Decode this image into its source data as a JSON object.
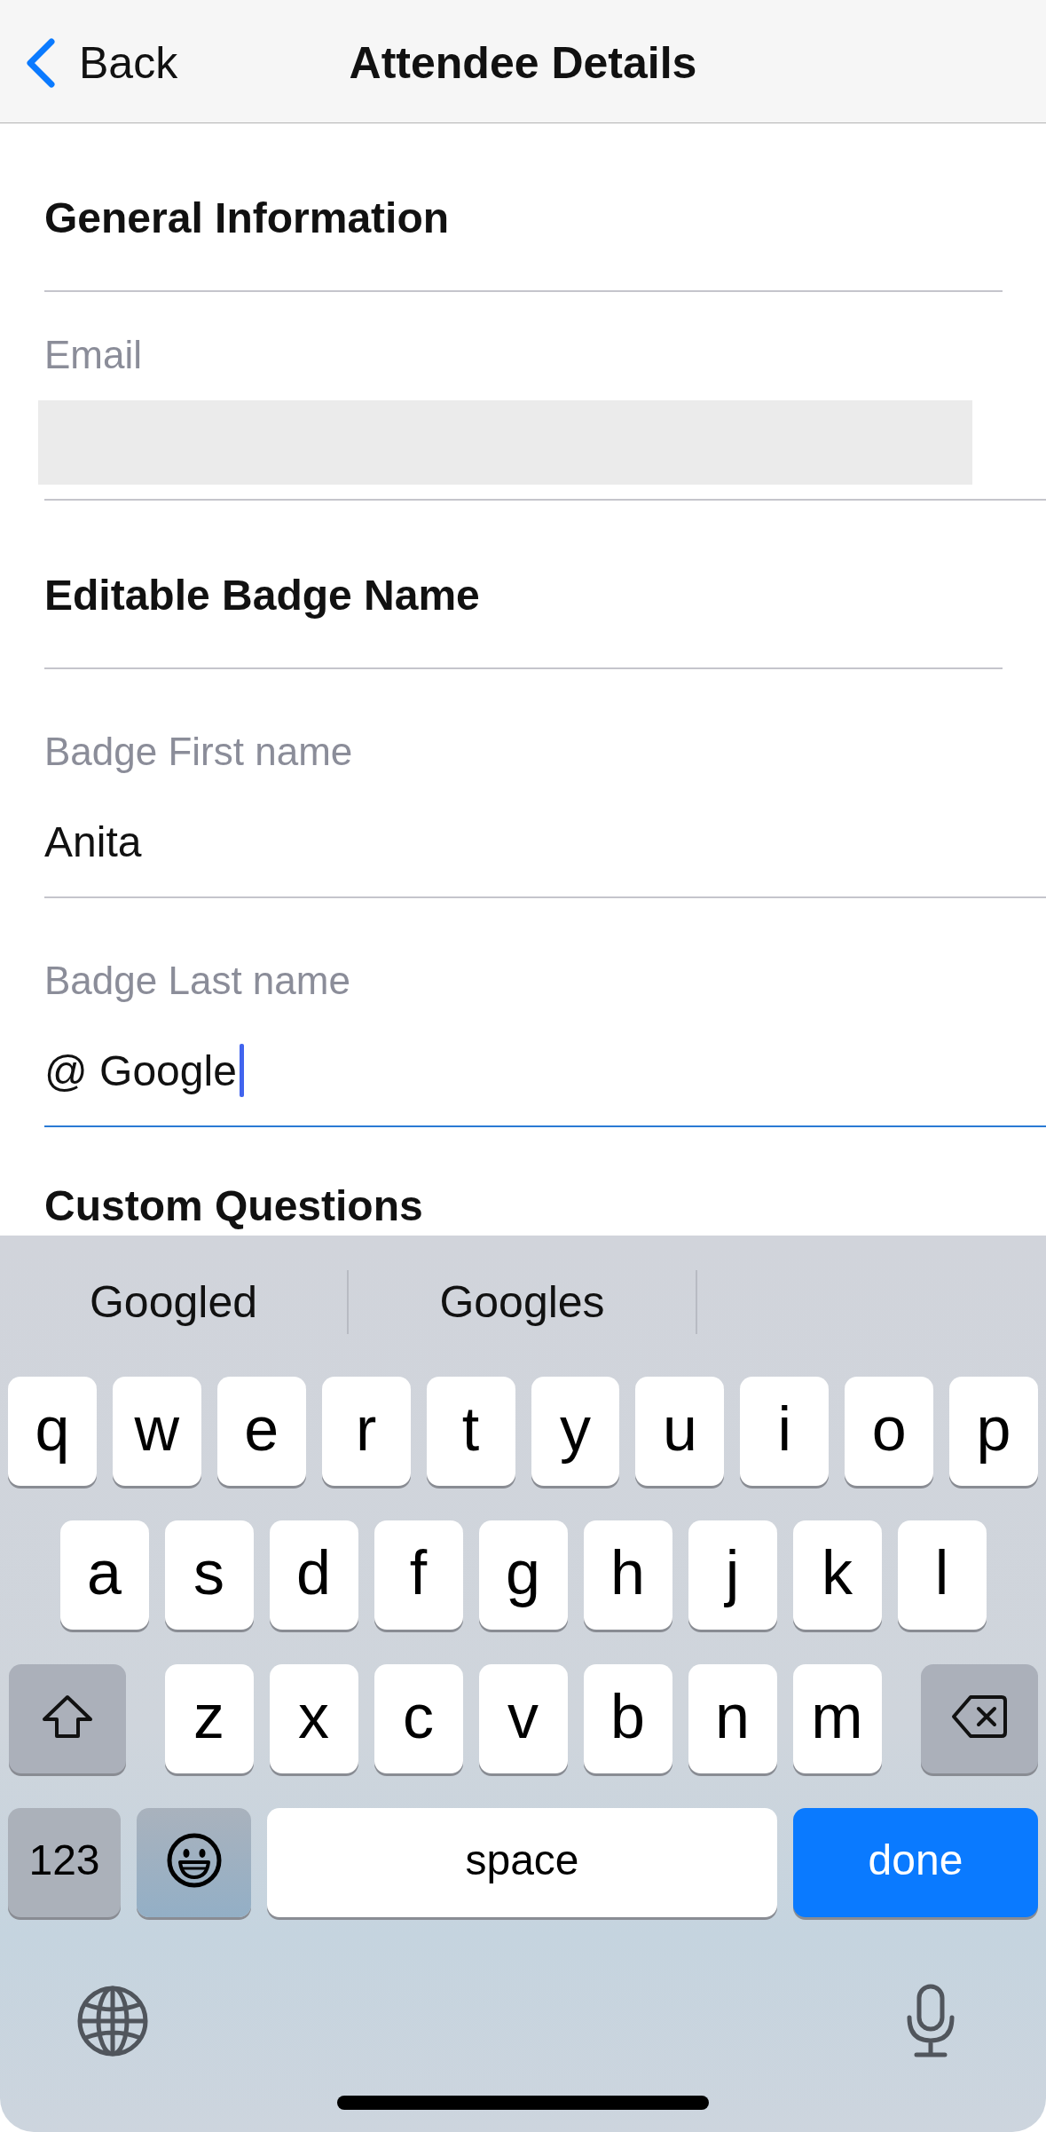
{
  "nav": {
    "back_label": "Back",
    "title": "Attendee Details"
  },
  "sections": [
    {
      "heading": "General Information",
      "fields": [
        {
          "label": "Email",
          "disabled": true,
          "focused": false
        }
      ]
    },
    {
      "heading": "Editable Badge Name",
      "fields": [
        {
          "label": "Badge First name",
          "value": "Anita",
          "disabled": false,
          "focused": false
        },
        {
          "label": "Badge Last name",
          "value": "@ Google",
          "disabled": false,
          "focused": true
        }
      ]
    },
    {
      "heading": "Custom Questions"
    }
  ],
  "keyboard": {
    "suggestions": [
      "Googled",
      "Googles"
    ],
    "key_rows": [
      {
        "keys": [
          {
            "kind": "letter",
            "label": "q"
          },
          {
            "kind": "letter",
            "label": "w"
          },
          {
            "kind": "letter",
            "label": "e"
          },
          {
            "kind": "letter",
            "label": "r"
          },
          {
            "kind": "letter",
            "label": "t"
          },
          {
            "kind": "letter",
            "label": "y"
          },
          {
            "kind": "letter",
            "label": "u"
          },
          {
            "kind": "letter",
            "label": "i"
          },
          {
            "kind": "letter",
            "label": "o"
          },
          {
            "kind": "letter",
            "label": "p"
          }
        ]
      },
      {
        "keys": [
          {
            "kind": "letter",
            "label": "a"
          },
          {
            "kind": "letter",
            "label": "s"
          },
          {
            "kind": "letter",
            "label": "d"
          },
          {
            "kind": "letter",
            "label": "f"
          },
          {
            "kind": "letter",
            "label": "g"
          },
          {
            "kind": "letter",
            "label": "h"
          },
          {
            "kind": "letter",
            "label": "j"
          },
          {
            "kind": "letter",
            "label": "k"
          },
          {
            "kind": "letter",
            "label": "l"
          }
        ]
      },
      {
        "keys": [
          {
            "kind": "shift"
          },
          {
            "kind": "letter",
            "label": "z"
          },
          {
            "kind": "letter",
            "label": "x"
          },
          {
            "kind": "letter",
            "label": "c"
          },
          {
            "kind": "letter",
            "label": "v"
          },
          {
            "kind": "letter",
            "label": "b"
          },
          {
            "kind": "letter",
            "label": "n"
          },
          {
            "kind": "letter",
            "label": "m"
          },
          {
            "kind": "delete"
          }
        ]
      },
      {
        "keys": [
          {
            "kind": "mode",
            "label": "123"
          },
          {
            "kind": "emoji"
          },
          {
            "kind": "space",
            "label": "space"
          },
          {
            "kind": "done",
            "label": "done"
          }
        ]
      }
    ],
    "bottom": [
      {
        "kind": "globe"
      },
      {
        "kind": "dictation"
      }
    ]
  }
}
